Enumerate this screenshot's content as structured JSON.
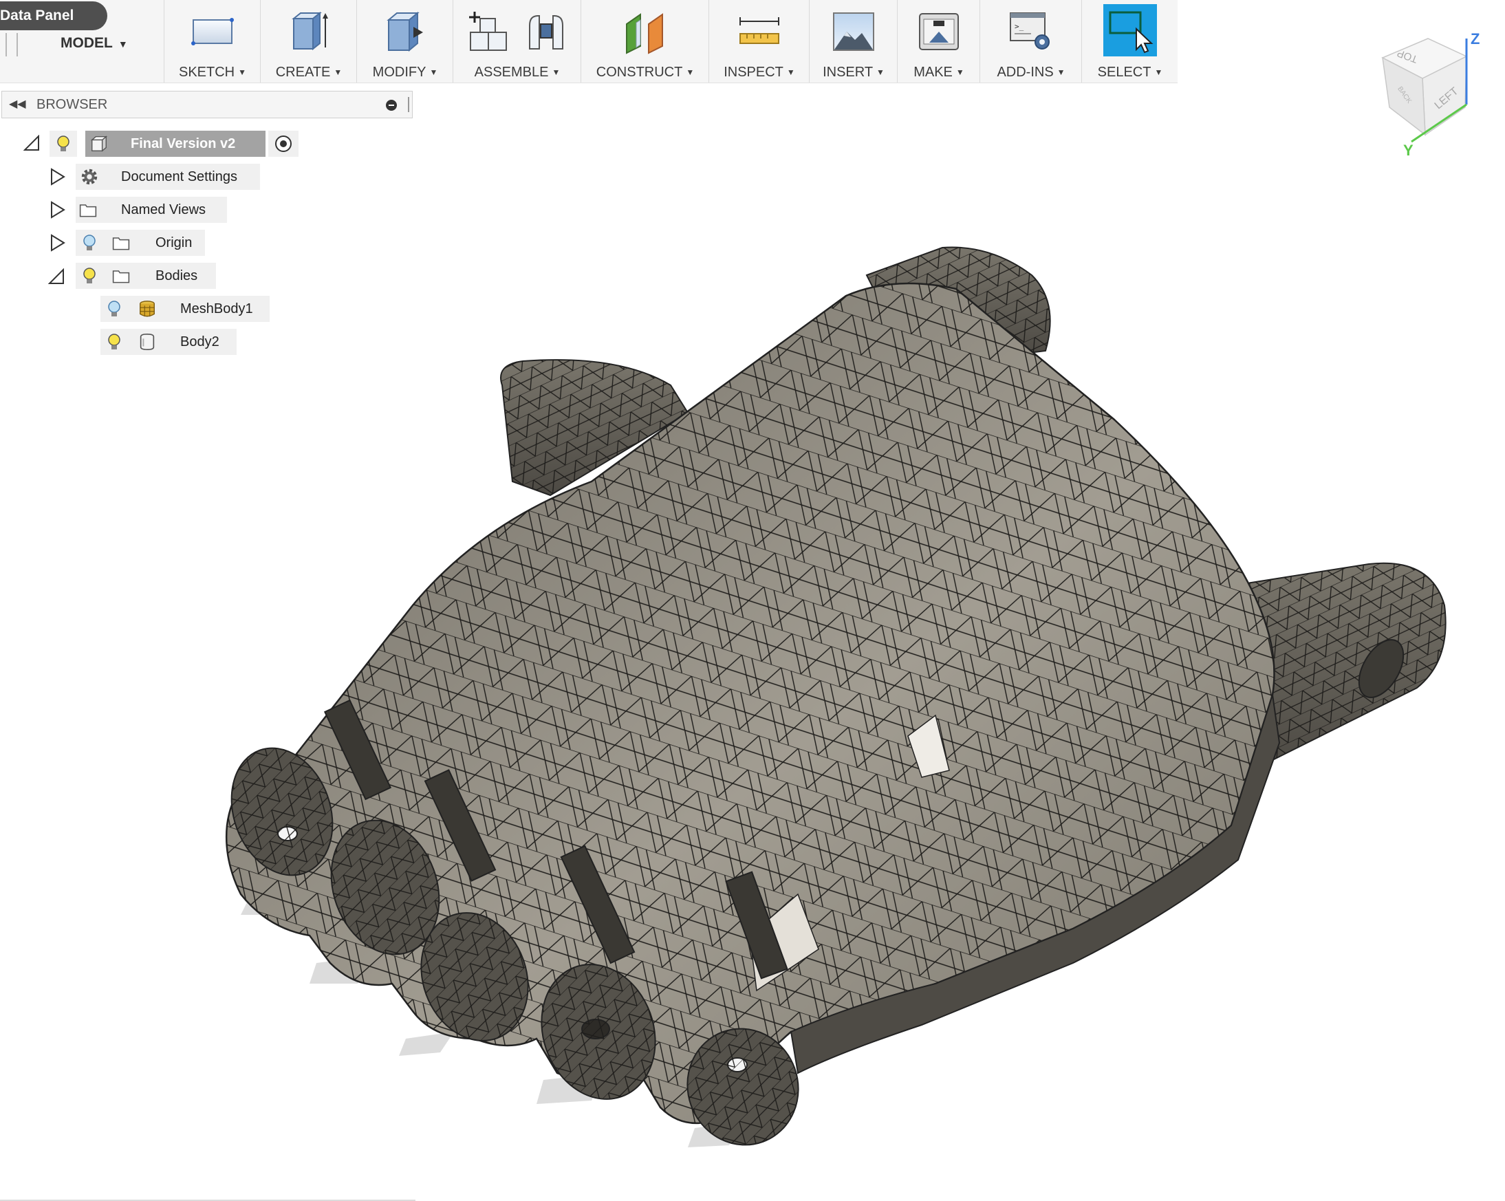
{
  "toolbar": {
    "data_panel_label": "Data Panel",
    "workspace_label": "MODEL",
    "groups": [
      {
        "label": "SKETCH"
      },
      {
        "label": "CREATE"
      },
      {
        "label": "MODIFY"
      },
      {
        "label": "ASSEMBLE"
      },
      {
        "label": "CONSTRUCT"
      },
      {
        "label": "INSPECT"
      },
      {
        "label": "INSERT"
      },
      {
        "label": "MAKE"
      },
      {
        "label": "ADD-INS"
      },
      {
        "label": "SELECT"
      }
    ],
    "select_accent": "#1a9ee0"
  },
  "browser": {
    "title": "BROWSER",
    "root": {
      "label": "Final Version v2"
    },
    "items": [
      {
        "label": "Document Settings",
        "icon": "gear-icon"
      },
      {
        "label": "Named Views",
        "icon": "folder-icon"
      },
      {
        "label": "Origin",
        "icon": "folder-icon"
      },
      {
        "label": "Bodies",
        "icon": "folder-icon"
      },
      {
        "label": "MeshBody1",
        "icon": "mesh-body-icon"
      },
      {
        "label": "Body2",
        "icon": "solid-body-icon"
      }
    ]
  },
  "viewcube": {
    "faces": [
      "TOP",
      "LEFT",
      "BACK"
    ],
    "axes": [
      "Z",
      "Y"
    ],
    "z_axis_color": "#3b7de0",
    "y_axis_color": "#5cc94a"
  },
  "model": {
    "name": "MeshBody1",
    "shade_color": "#8a857a",
    "edge_color": "#222222"
  }
}
